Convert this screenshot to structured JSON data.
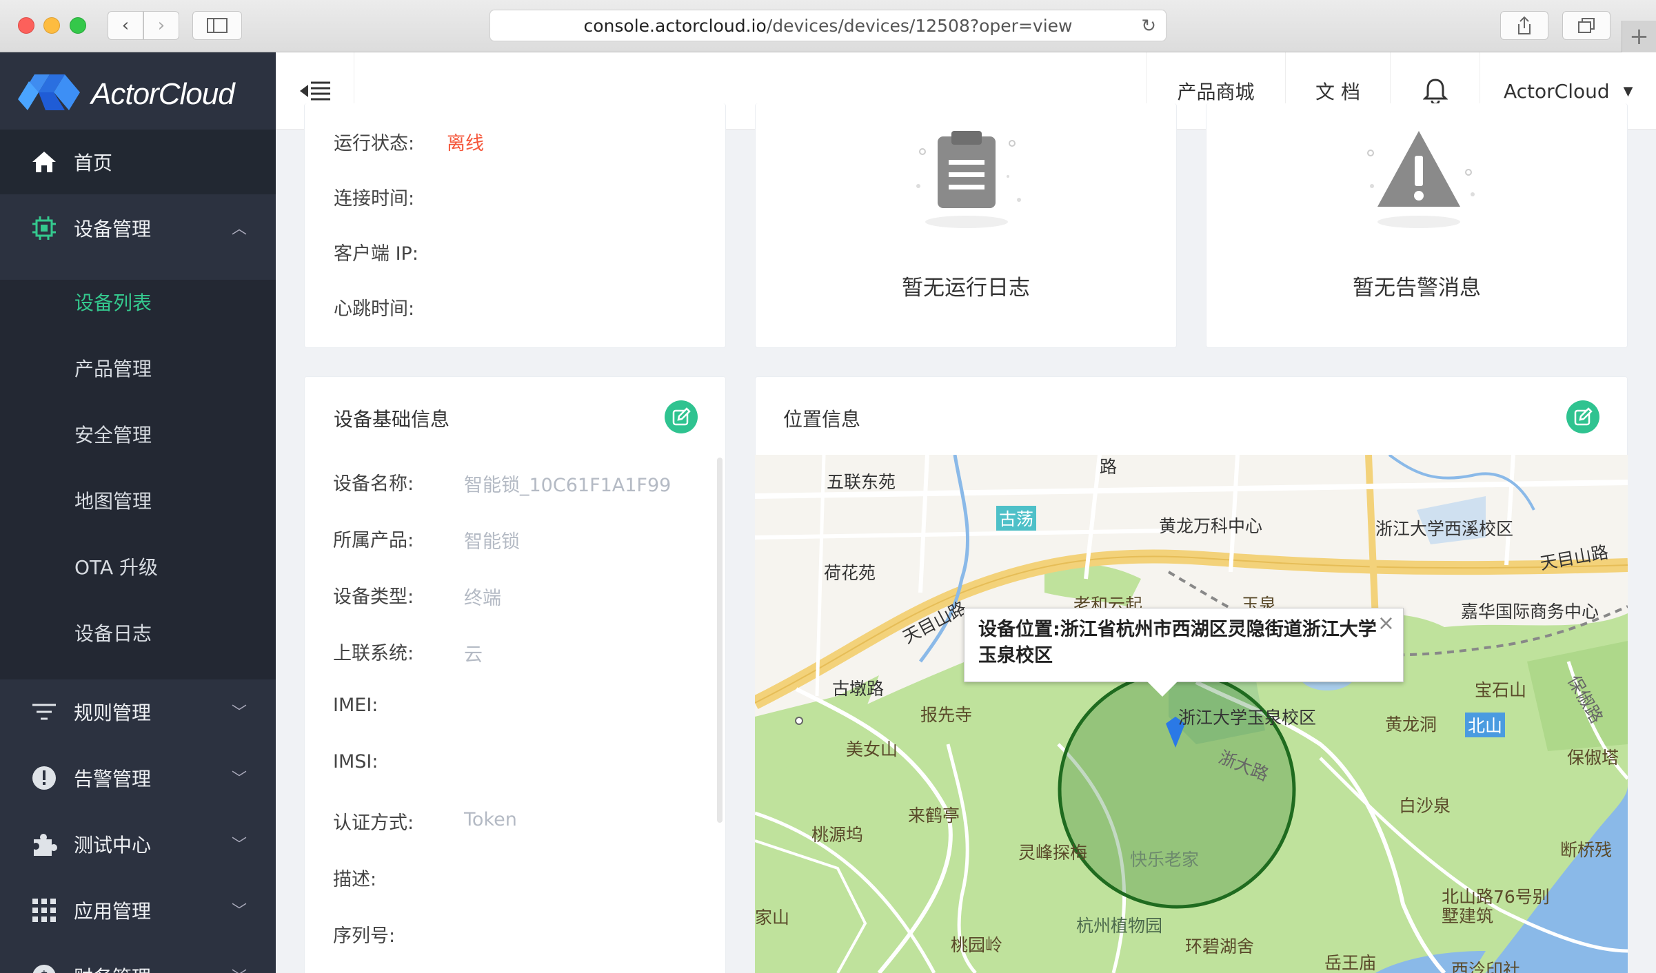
{
  "browser": {
    "url_host": "console.actorcloud.io",
    "url_path": "/devices/devices/12508?oper=view"
  },
  "sidebar": {
    "brand": "ActorCloud",
    "items": [
      {
        "label": "首页",
        "icon": "home-icon"
      },
      {
        "label": "设备管理",
        "icon": "chip-icon"
      },
      {
        "label": "规则管理",
        "icon": "filter-icon"
      },
      {
        "label": "告警管理",
        "icon": "alert-icon"
      },
      {
        "label": "测试中心",
        "icon": "puzzle-icon"
      },
      {
        "label": "应用管理",
        "icon": "grid-icon"
      },
      {
        "label": "财务管理",
        "icon": "dollar-icon"
      }
    ],
    "sub_items": [
      "设备列表",
      "产品管理",
      "安全管理",
      "地图管理",
      "OTA 升级",
      "设备日志"
    ],
    "active_sub": "设备列表",
    "accent": "#34c98e"
  },
  "header": {
    "links": [
      "产品商城",
      "文 档"
    ],
    "user": "ActorCloud"
  },
  "status_card": {
    "rows": [
      {
        "label": "运行状态:",
        "value": "离线"
      },
      {
        "label": "连接时间:",
        "value": ""
      },
      {
        "label": "客户端 IP:",
        "value": ""
      },
      {
        "label": "心跳时间:",
        "value": ""
      }
    ]
  },
  "log_card": {
    "empty_text": "暂无运行日志"
  },
  "alarm_card": {
    "empty_text": "暂无告警消息"
  },
  "basic_info": {
    "title": "设备基础信息",
    "rows": [
      {
        "label": "设备名称:",
        "value": "智能锁_10C61F1A1F99"
      },
      {
        "label": "所属产品:",
        "value": "智能锁"
      },
      {
        "label": "设备类型:",
        "value": "终端"
      },
      {
        "label": "上联系统:",
        "value": "云"
      },
      {
        "label": "IMEI:",
        "value": ""
      },
      {
        "label": "IMSI:",
        "value": ""
      },
      {
        "label": "认证方式:",
        "value": "Token"
      },
      {
        "label": "描述:",
        "value": ""
      },
      {
        "label": "序列号:",
        "value": ""
      }
    ]
  },
  "location": {
    "title": "位置信息",
    "popup_text": "设备位置:浙江省杭州市西湖区灵隐街道浙江大学玉泉校区",
    "map_labels": [
      "五联东苑",
      "古荡",
      "黄龙万科中心",
      "浙江大学西溪校区",
      "天目山路",
      "荷花苑",
      "嘉华国际商务中心",
      "天目山路",
      "古墩路",
      "报先寺",
      "浙江大学玉泉校区",
      "宝石山",
      "黄龙洞",
      "北山",
      "美女山",
      "浙大路",
      "白沙泉",
      "保俶塔",
      "来鹤亭",
      "桃源坞",
      "灵峰探梅",
      "快乐老家",
      "断桥残",
      "家山",
      "桃园岭",
      "杭州植物园",
      "北山路76号别墅建筑",
      "环碧湖舍",
      "岳王庙",
      "西泠印社",
      "路",
      "老和云起",
      "玉泉",
      "保俶路"
    ]
  }
}
